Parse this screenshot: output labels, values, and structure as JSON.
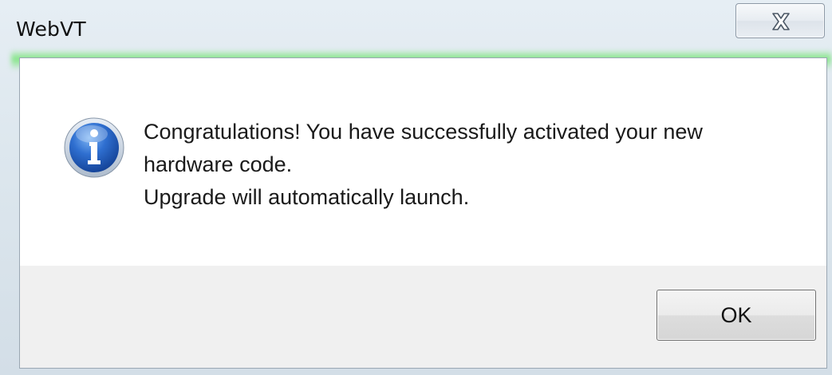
{
  "window": {
    "title": "WebVT",
    "close_icon": "close-icon"
  },
  "dialog": {
    "icon": "info-icon",
    "message_lines": [
      "Congratulations! You have successfully activated your new",
      "hardware code.",
      "Upgrade will automatically launch."
    ],
    "ok_label": "OK"
  },
  "colors": {
    "content_bg": "#ffffff",
    "footer_bg": "#f0f0f0",
    "title_glow": "#70e470",
    "icon_blue": "#2a63c4"
  }
}
